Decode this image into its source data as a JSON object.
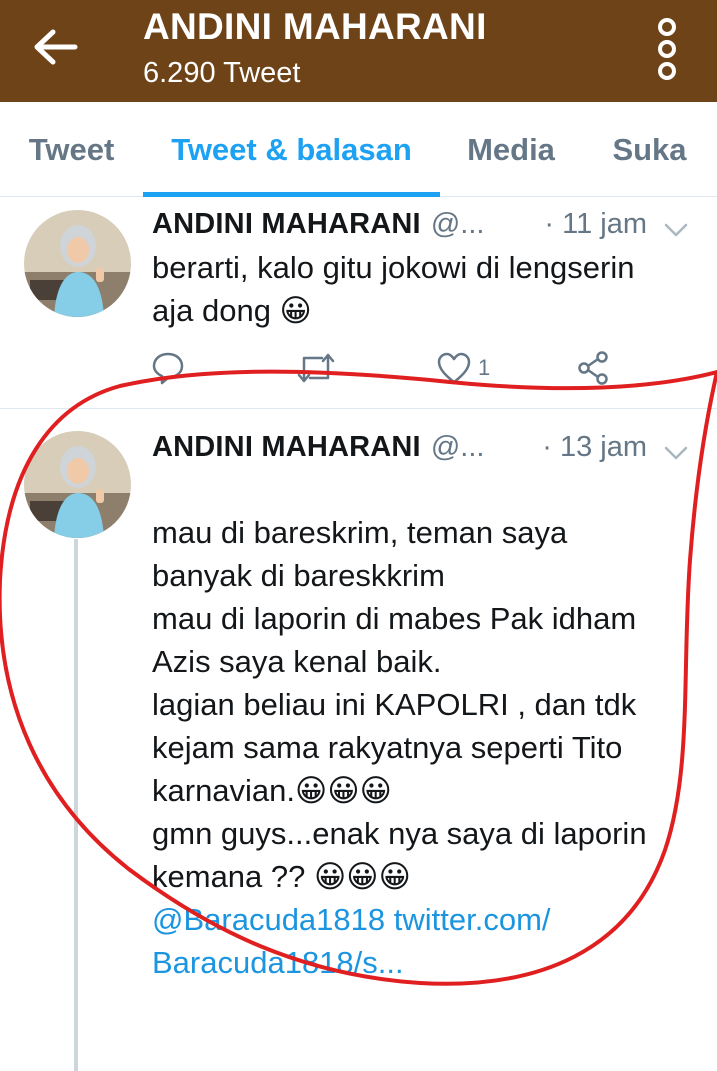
{
  "header": {
    "title": "ANDINI MAHARANI",
    "subtitle": "6.290 Tweet",
    "background": "#6e4318"
  },
  "tabs": [
    {
      "label": "Tweet",
      "active": false
    },
    {
      "label": "Tweet & balasan",
      "active": true
    },
    {
      "label": "Media",
      "active": false
    },
    {
      "label": "Suka",
      "active": false
    }
  ],
  "accent_color": "#1da1f2",
  "tweets": [
    {
      "name": "ANDINI MAHARANI",
      "handle": "@...",
      "time": "· 11 jam",
      "text": "berarti, kalo gitu jokowi di lengserin\naja dong 😀",
      "actions": {
        "reply_icon": "reply-icon",
        "retweet_icon": "retweet-icon",
        "like_icon": "heart-icon",
        "like_count": "1",
        "share_icon": "share-icon"
      }
    },
    {
      "name": "ANDINI MAHARANI",
      "handle": "@...",
      "time": "· 13 jam",
      "text": "mau di bareskrim, teman saya\nbanyak di bareskkrim\nmau di laporin di mabes Pak idham\nAzis saya kenal baik.\nlagian beliau ini KAPOLRI , dan  tdk\nkejam sama rakyatnya seperti Tito\nkarnavian.😀😀😀\ngmn guys...enak nya saya di laporin\nkemana ?? 😀😀😀",
      "link": "@Baracuda1818 twitter.com/\nBaracuda1818/s..."
    }
  ],
  "annotation_color": "#e02020"
}
